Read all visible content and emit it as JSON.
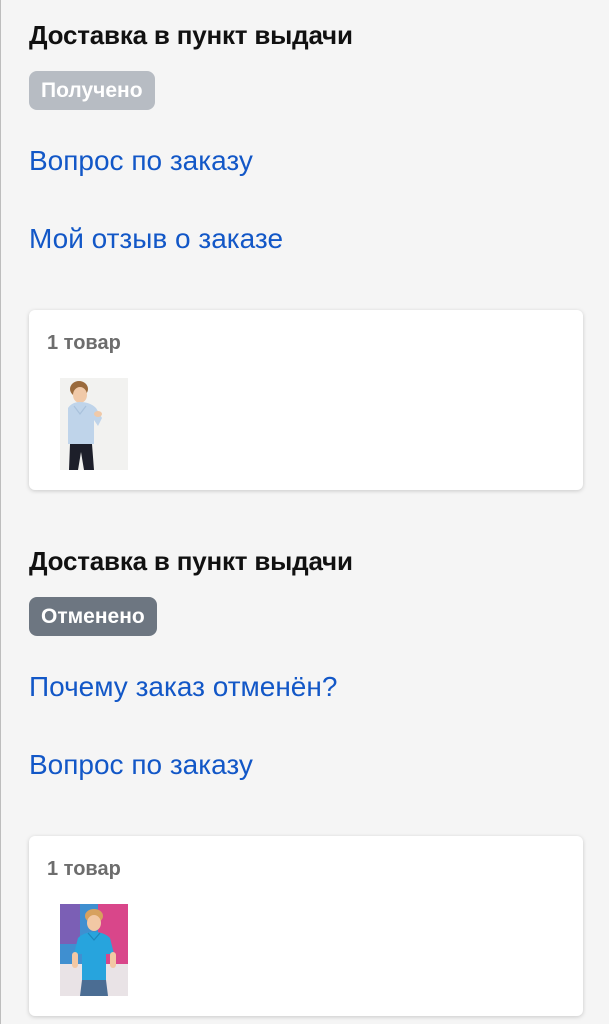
{
  "orders": [
    {
      "delivery_title": "Доставка в пункт выдачи",
      "status": "Получено",
      "links": [
        "Вопрос по заказу",
        "Мой отзыв о заказе"
      ],
      "items_count": "1 товар"
    },
    {
      "delivery_title": "Доставка в пункт выдачи",
      "status": "Отменено",
      "links": [
        "Почему заказ отменён?",
        "Вопрос по заказу"
      ],
      "items_count": "1 товар"
    }
  ],
  "colors": {
    "link": "#1257c7",
    "badge_received": "#b7bcc3",
    "badge_cancelled": "#6d7681"
  }
}
